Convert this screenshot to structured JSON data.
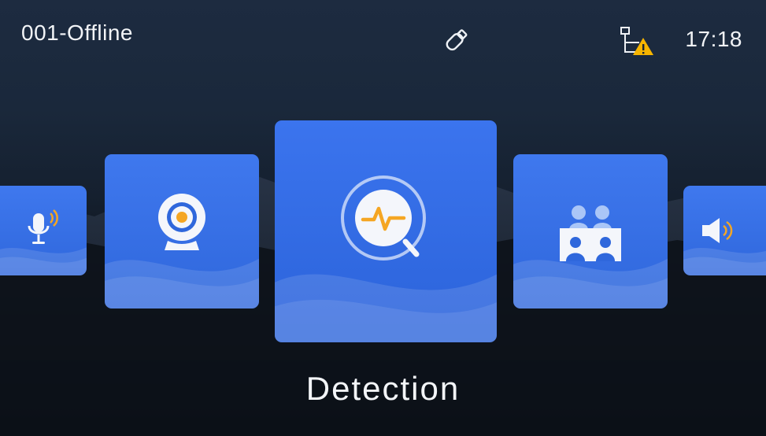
{
  "status_bar": {
    "device_name": "001-Offline",
    "time": "17:18",
    "usb_icon": "usb-drive-icon",
    "network_icon": "network-warning-icon"
  },
  "menu": {
    "selected_label": "Detection",
    "items": [
      {
        "id": "voice",
        "icon": "microphone-icon"
      },
      {
        "id": "camera",
        "icon": "webcam-icon"
      },
      {
        "id": "detection",
        "icon": "detection-search-icon"
      },
      {
        "id": "group",
        "icon": "group-meeting-icon"
      },
      {
        "id": "volume",
        "icon": "speaker-volume-icon"
      }
    ]
  },
  "colors": {
    "card_blue": "#3a72ea",
    "accent_orange": "#f5a623",
    "warning_yellow": "#f7b500"
  }
}
